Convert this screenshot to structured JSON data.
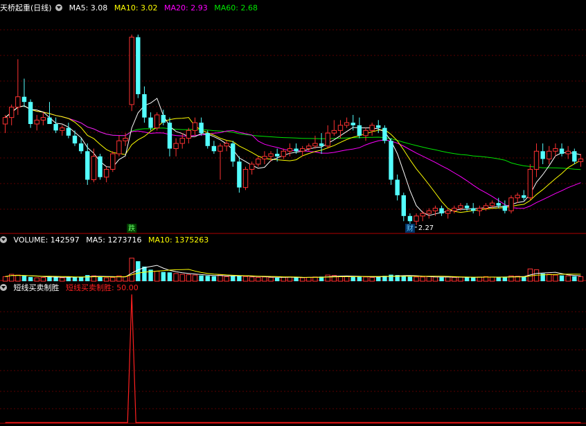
{
  "price_panel": {
    "title": "天桥起重(日线)",
    "ma5_label": "MA5: 3.08",
    "ma10_label": "MA10: 3.02",
    "ma20_label": "MA20: 2.93",
    "ma60_label": "MA60: 2.68",
    "low_annotation": "2.27",
    "marker_fall": "跌",
    "marker_cai": "财"
  },
  "volume_panel": {
    "volume_label": "VOLUME: 142597",
    "ma5_label": "MA5: 1273716",
    "ma10_label": "MA10: 1375263"
  },
  "indicator_panel": {
    "name": "短线买卖制胜",
    "value_label": "短线买卖制胜: 50.00"
  },
  "colors": {
    "background": "#000000",
    "up": "#ff3232",
    "down": "#54ffff",
    "ma5": "#ffffff",
    "ma10": "#ffff00",
    "ma20": "#ff00ff",
    "ma60": "#00e600",
    "indicator": "#ff2020",
    "panel_border": "#b00000"
  },
  "chart_data": {
    "type": "candlestick",
    "price_range": [
      2.2,
      3.9
    ],
    "candles": [
      [
        3.05,
        3.12,
        2.98,
        3.1
      ],
      [
        3.1,
        3.2,
        3.04,
        3.18
      ],
      [
        3.18,
        3.55,
        3.12,
        3.26
      ],
      [
        3.26,
        3.4,
        3.18,
        3.22
      ],
      [
        3.22,
        3.24,
        3.02,
        3.05
      ],
      [
        3.05,
        3.12,
        3.0,
        3.08
      ],
      [
        3.08,
        3.14,
        3.04,
        3.1
      ],
      [
        3.1,
        3.22,
        3.06,
        3.05
      ],
      [
        3.05,
        3.1,
        2.98,
        3.0
      ],
      [
        3.0,
        3.04,
        2.96,
        3.02
      ],
      [
        3.02,
        3.06,
        2.94,
        2.96
      ],
      [
        2.96,
        3.0,
        2.88,
        2.9
      ],
      [
        2.9,
        2.94,
        2.82,
        2.84
      ],
      [
        2.84,
        2.9,
        2.58,
        2.62
      ],
      [
        2.62,
        2.86,
        2.6,
        2.8
      ],
      [
        2.8,
        2.82,
        2.62,
        2.64
      ],
      [
        2.64,
        2.72,
        2.6,
        2.7
      ],
      [
        2.7,
        2.84,
        2.68,
        2.82
      ],
      [
        2.82,
        2.96,
        2.8,
        2.92
      ],
      [
        2.92,
        2.98,
        2.88,
        2.94
      ],
      [
        3.2,
        3.74,
        3.15,
        3.72
      ],
      [
        3.72,
        3.74,
        3.25,
        3.28
      ],
      [
        3.28,
        3.34,
        3.06,
        3.1
      ],
      [
        3.1,
        3.14,
        3.0,
        3.02
      ],
      [
        3.02,
        3.14,
        3.0,
        3.12
      ],
      [
        3.12,
        3.16,
        3.04,
        3.06
      ],
      [
        3.06,
        3.1,
        2.8,
        2.86
      ],
      [
        2.86,
        2.94,
        2.8,
        2.9
      ],
      [
        2.9,
        2.98,
        2.86,
        2.94
      ],
      [
        2.94,
        3.02,
        2.9,
        3.0
      ],
      [
        3.0,
        3.1,
        2.96,
        3.06
      ],
      [
        3.06,
        3.1,
        2.96,
        2.98
      ],
      [
        2.98,
        3.0,
        2.86,
        2.88
      ],
      [
        2.88,
        2.92,
        2.82,
        2.84
      ],
      [
        2.84,
        2.9,
        2.62,
        2.88
      ],
      [
        2.88,
        2.92,
        2.84,
        2.9
      ],
      [
        2.9,
        2.92,
        2.72,
        2.76
      ],
      [
        2.76,
        2.8,
        2.52,
        2.56
      ],
      [
        2.56,
        2.72,
        2.54,
        2.7
      ],
      [
        2.7,
        2.76,
        2.66,
        2.74
      ],
      [
        2.74,
        2.8,
        2.72,
        2.78
      ],
      [
        2.78,
        2.84,
        2.74,
        2.8
      ],
      [
        2.8,
        2.84,
        2.76,
        2.82
      ],
      [
        2.82,
        2.86,
        2.76,
        2.8
      ],
      [
        2.8,
        2.86,
        2.78,
        2.84
      ],
      [
        2.84,
        2.9,
        2.8,
        2.86
      ],
      [
        2.86,
        2.9,
        2.82,
        2.84
      ],
      [
        2.84,
        2.88,
        2.8,
        2.86
      ],
      [
        2.86,
        2.9,
        2.84,
        2.88
      ],
      [
        2.88,
        2.96,
        2.86,
        2.9
      ],
      [
        2.9,
        2.98,
        2.82,
        2.88
      ],
      [
        2.88,
        3.04,
        2.86,
        2.98
      ],
      [
        2.98,
        3.08,
        2.96,
        3.0
      ],
      [
        3.0,
        3.08,
        2.94,
        3.04
      ],
      [
        3.04,
        3.1,
        3.02,
        3.06
      ],
      [
        3.06,
        3.12,
        3.0,
        3.04
      ],
      [
        3.04,
        3.1,
        2.94,
        2.96
      ],
      [
        2.96,
        3.02,
        2.92,
        3.0
      ],
      [
        3.0,
        3.06,
        2.96,
        3.04
      ],
      [
        3.04,
        3.08,
        2.98,
        3.02
      ],
      [
        3.02,
        3.04,
        2.9,
        2.92
      ],
      [
        2.92,
        2.94,
        2.58,
        2.62
      ],
      [
        2.62,
        2.66,
        2.46,
        2.5
      ],
      [
        2.5,
        2.52,
        2.3,
        2.34
      ],
      [
        2.34,
        2.36,
        2.26,
        2.3
      ],
      [
        2.3,
        2.36,
        2.27,
        2.34
      ],
      [
        2.34,
        2.38,
        2.3,
        2.36
      ],
      [
        2.36,
        2.4,
        2.32,
        2.38
      ],
      [
        2.38,
        2.42,
        2.34,
        2.4
      ],
      [
        2.4,
        2.42,
        2.34,
        2.36
      ],
      [
        2.36,
        2.4,
        2.32,
        2.38
      ],
      [
        2.38,
        2.42,
        2.36,
        2.4
      ],
      [
        2.4,
        2.44,
        2.38,
        2.42
      ],
      [
        2.42,
        2.44,
        2.38,
        2.4
      ],
      [
        2.4,
        2.44,
        2.36,
        2.38
      ],
      [
        2.38,
        2.42,
        2.34,
        2.4
      ],
      [
        2.4,
        2.44,
        2.38,
        2.42
      ],
      [
        2.42,
        2.46,
        2.4,
        2.44
      ],
      [
        2.44,
        2.48,
        2.4,
        2.42
      ],
      [
        2.42,
        2.46,
        2.36,
        2.38
      ],
      [
        2.38,
        2.5,
        2.36,
        2.48
      ],
      [
        2.48,
        2.52,
        2.44,
        2.5
      ],
      [
        2.5,
        2.54,
        2.46,
        2.48
      ],
      [
        2.48,
        2.74,
        2.46,
        2.7
      ],
      [
        2.7,
        2.9,
        2.64,
        2.84
      ],
      [
        2.84,
        2.9,
        2.74,
        2.78
      ],
      [
        2.78,
        2.88,
        2.74,
        2.84
      ],
      [
        2.84,
        2.9,
        2.8,
        2.86
      ],
      [
        2.86,
        2.9,
        2.8,
        2.82
      ],
      [
        2.82,
        2.88,
        2.78,
        2.84
      ],
      [
        2.84,
        2.86,
        2.74,
        2.76
      ],
      [
        2.76,
        2.82,
        2.72,
        2.78
      ]
    ],
    "volume": [
      120,
      180,
      160,
      140,
      110,
      90,
      100,
      130,
      110,
      90,
      100,
      110,
      120,
      160,
      140,
      110,
      90,
      100,
      140,
      120,
      600,
      520,
      380,
      300,
      260,
      240,
      230,
      200,
      180,
      170,
      160,
      150,
      140,
      130,
      160,
      120,
      140,
      150,
      120,
      110,
      100,
      110,
      100,
      90,
      100,
      110,
      100,
      90,
      100,
      110,
      120,
      160,
      150,
      130,
      120,
      110,
      130,
      110,
      100,
      110,
      140,
      170,
      160,
      150,
      120,
      110,
      110,
      120,
      110,
      100,
      110,
      100,
      110,
      100,
      100,
      110,
      120,
      110,
      100,
      110,
      140,
      130,
      120,
      320,
      300,
      200,
      180,
      160,
      150,
      140,
      130,
      120
    ],
    "volume_range": [
      0,
      900
    ],
    "indicator_range": [
      0,
      100
    ],
    "indicator_spike": {
      "index": 20,
      "value": 100
    }
  }
}
